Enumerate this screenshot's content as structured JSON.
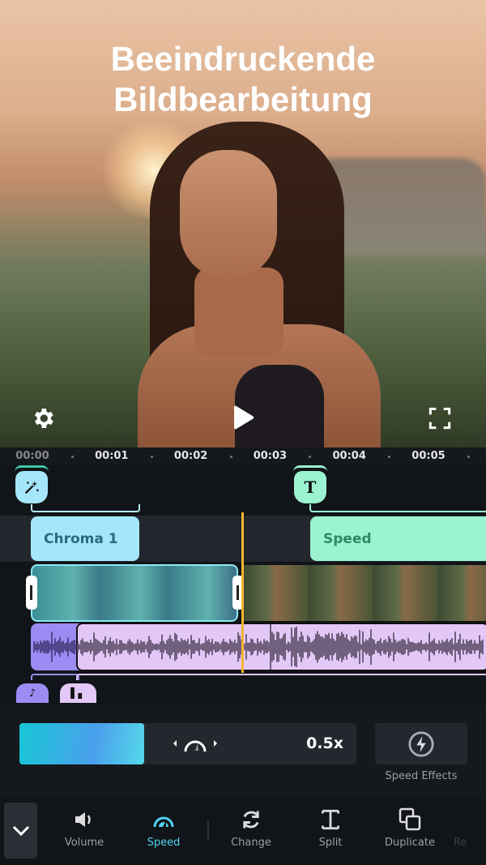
{
  "preview": {
    "title_line1": "Beeindruckende",
    "title_line2": "Bildbearbeitung"
  },
  "ruler": {
    "ticks": [
      "00:00",
      "00:01",
      "00:02",
      "00:03",
      "00:04",
      "00:05"
    ]
  },
  "tracks": {
    "effect_clip": "Chroma 1",
    "text_clip": "Speed"
  },
  "speed": {
    "value_label": "0.5x",
    "fill_fraction": 0.37,
    "effects_label": "Speed Effects"
  },
  "toolbar": {
    "items": [
      "Volume",
      "Speed",
      "Change",
      "Split",
      "Duplicate",
      "Re"
    ],
    "active": "Speed"
  },
  "colors": {
    "accent": "#4fd2f0",
    "playhead": "#f2b532",
    "chroma": "#a6e6fb",
    "text_clip": "#9cf3d2",
    "audio": "#e3c8f7"
  }
}
